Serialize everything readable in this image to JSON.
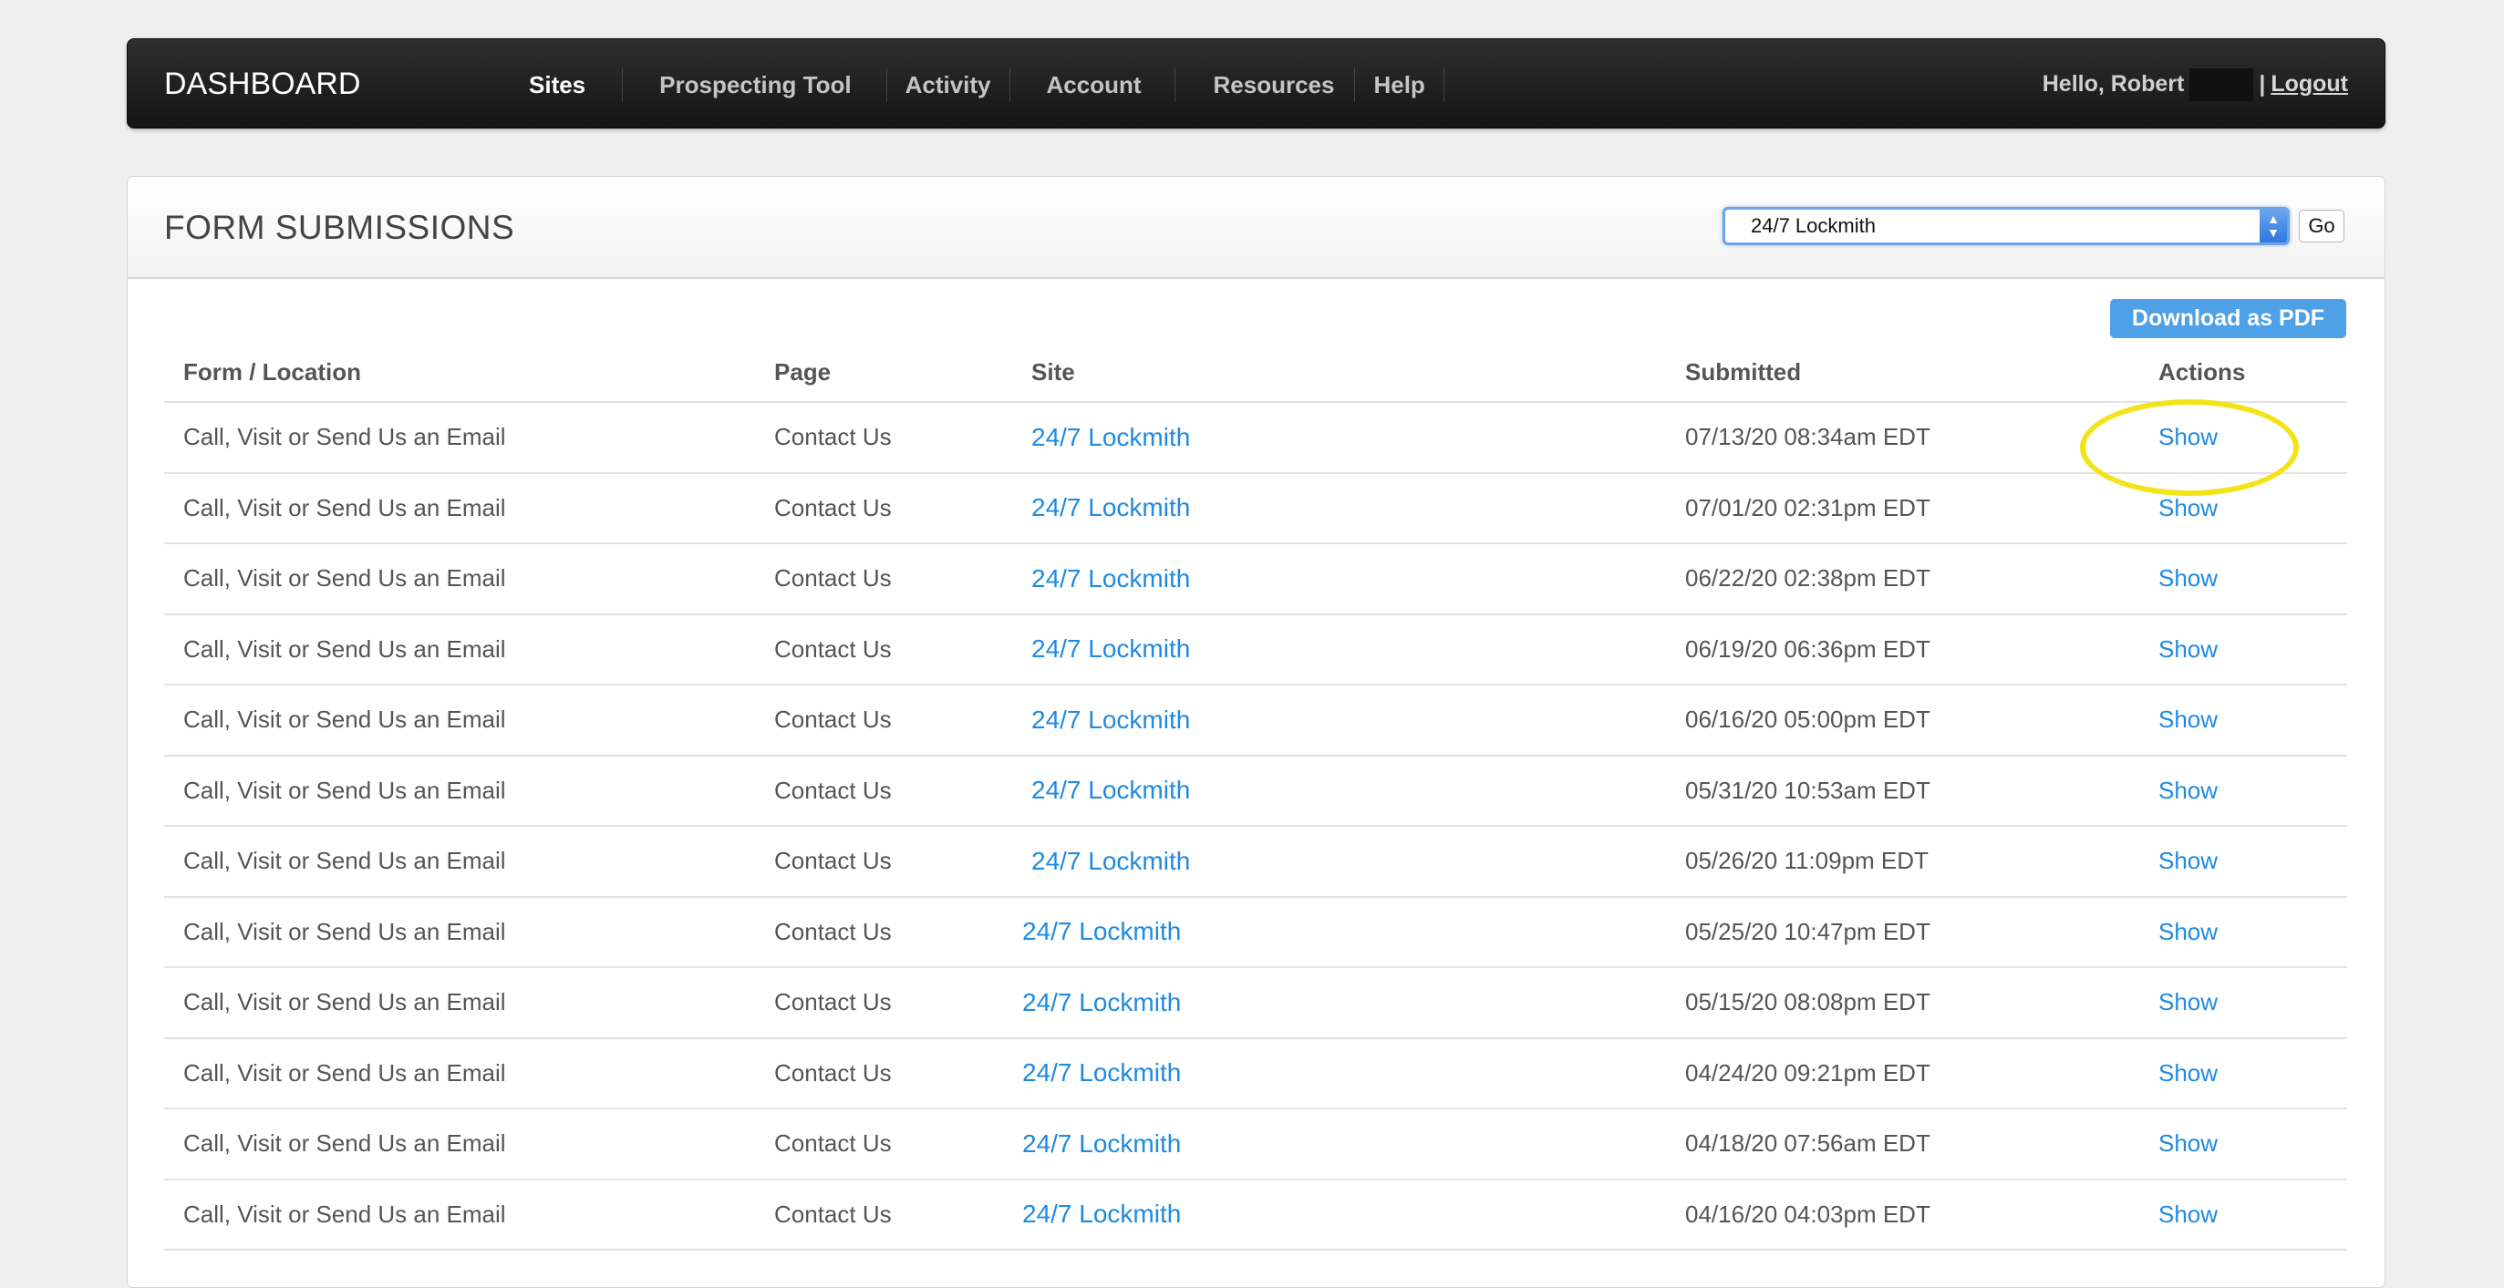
{
  "nav": {
    "brand": "DASHBOARD",
    "items": [
      "Sites",
      "Prospecting Tool",
      "Activity",
      "Account",
      "Resources",
      "Help"
    ],
    "greeting": "Hello, Robert",
    "separator": "|",
    "logout": "Logout"
  },
  "panel": {
    "title": "FORM SUBMISSIONS",
    "site_select_value": "24/7 Lockmith",
    "go_label": "Go",
    "pdf_label": "Download as PDF"
  },
  "table": {
    "headers": [
      "Form / Location",
      "Page",
      "Site",
      "Submitted",
      "Actions"
    ],
    "rows": [
      {
        "form": "Call, Visit or Send Us an Email",
        "page": "Contact Us",
        "site": "24/7 Lockmith",
        "submitted": "07/13/20 08:34am EDT",
        "action": "Show"
      },
      {
        "form": "Call, Visit or Send Us an Email",
        "page": "Contact Us",
        "site": "24/7 Lockmith",
        "submitted": "07/01/20 02:31pm EDT",
        "action": "Show"
      },
      {
        "form": "Call, Visit or Send Us an Email",
        "page": "Contact Us",
        "site": "24/7 Lockmith",
        "submitted": "06/22/20 02:38pm EDT",
        "action": "Show"
      },
      {
        "form": "Call, Visit or Send Us an Email",
        "page": "Contact Us",
        "site": "24/7 Lockmith",
        "submitted": "06/19/20 06:36pm EDT",
        "action": "Show"
      },
      {
        "form": "Call, Visit or Send Us an Email",
        "page": "Contact Us",
        "site": "24/7 Lockmith",
        "submitted": "06/16/20 05:00pm EDT",
        "action": "Show"
      },
      {
        "form": "Call, Visit or Send Us an Email",
        "page": "Contact Us",
        "site": "24/7 Lockmith",
        "submitted": "05/31/20 10:53am EDT",
        "action": "Show"
      },
      {
        "form": "Call, Visit or Send Us an Email",
        "page": "Contact Us",
        "site": "24/7 Lockmith",
        "submitted": "05/26/20 11:09pm EDT",
        "action": "Show"
      },
      {
        "form": "Call, Visit or Send Us an Email",
        "page": "Contact Us",
        "site": "24/7 Lockmith",
        "submitted": "05/25/20 10:47pm EDT",
        "action": "Show"
      },
      {
        "form": "Call, Visit or Send Us an Email",
        "page": "Contact Us",
        "site": "24/7 Lockmith",
        "submitted": "05/15/20 08:08pm EDT",
        "action": "Show"
      },
      {
        "form": "Call, Visit or Send Us an Email",
        "page": "Contact Us",
        "site": "24/7 Lockmith",
        "submitted": "04/24/20 09:21pm EDT",
        "action": "Show"
      },
      {
        "form": "Call, Visit or Send Us an Email",
        "page": "Contact Us",
        "site": "24/7 Lockmith",
        "submitted": "04/18/20 07:56am EDT",
        "action": "Show"
      },
      {
        "form": "Call, Visit or Send Us an Email",
        "page": "Contact Us",
        "site": "24/7 Lockmith",
        "submitted": "04/16/20 04:03pm EDT",
        "action": "Show"
      }
    ]
  },
  "colors": {
    "link": "#1f8ae0",
    "pdf_button": "#4ea0e7",
    "highlight": "#f3e31a"
  }
}
